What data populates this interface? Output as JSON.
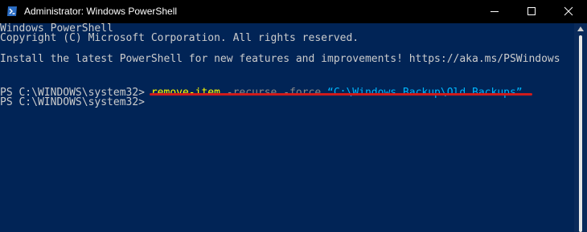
{
  "window": {
    "title": "Administrator: Windows PowerShell",
    "icons": {
      "app": "powershell-icon",
      "minimize": "minimize-icon",
      "maximize": "maximize-icon",
      "close": "close-icon"
    },
    "colors": {
      "titlebar_bg": "#000000",
      "console_bg": "#012456",
      "text": "#cccccc",
      "cmdlet": "#ffff00",
      "parameter": "#8a8a8a",
      "string": "#00b7ff",
      "annotation": "#d01b1b"
    }
  },
  "console": {
    "header_line_1": "Windows PowerShell",
    "header_line_2": "Copyright (C) Microsoft Corporation. All rights reserved.",
    "install_line": "Install the latest PowerShell for new features and improvements! https://aka.ms/PSWindows",
    "prompt_1": "PS C:\\WINDOWS\\system32> ",
    "command": {
      "cmdlet": "remove-item",
      "parameters": " -recurse -force ",
      "path_arg": "“C:\\Windows Backup\\Old Backups”"
    },
    "prompt_2": "PS C:\\WINDOWS\\system32>"
  }
}
